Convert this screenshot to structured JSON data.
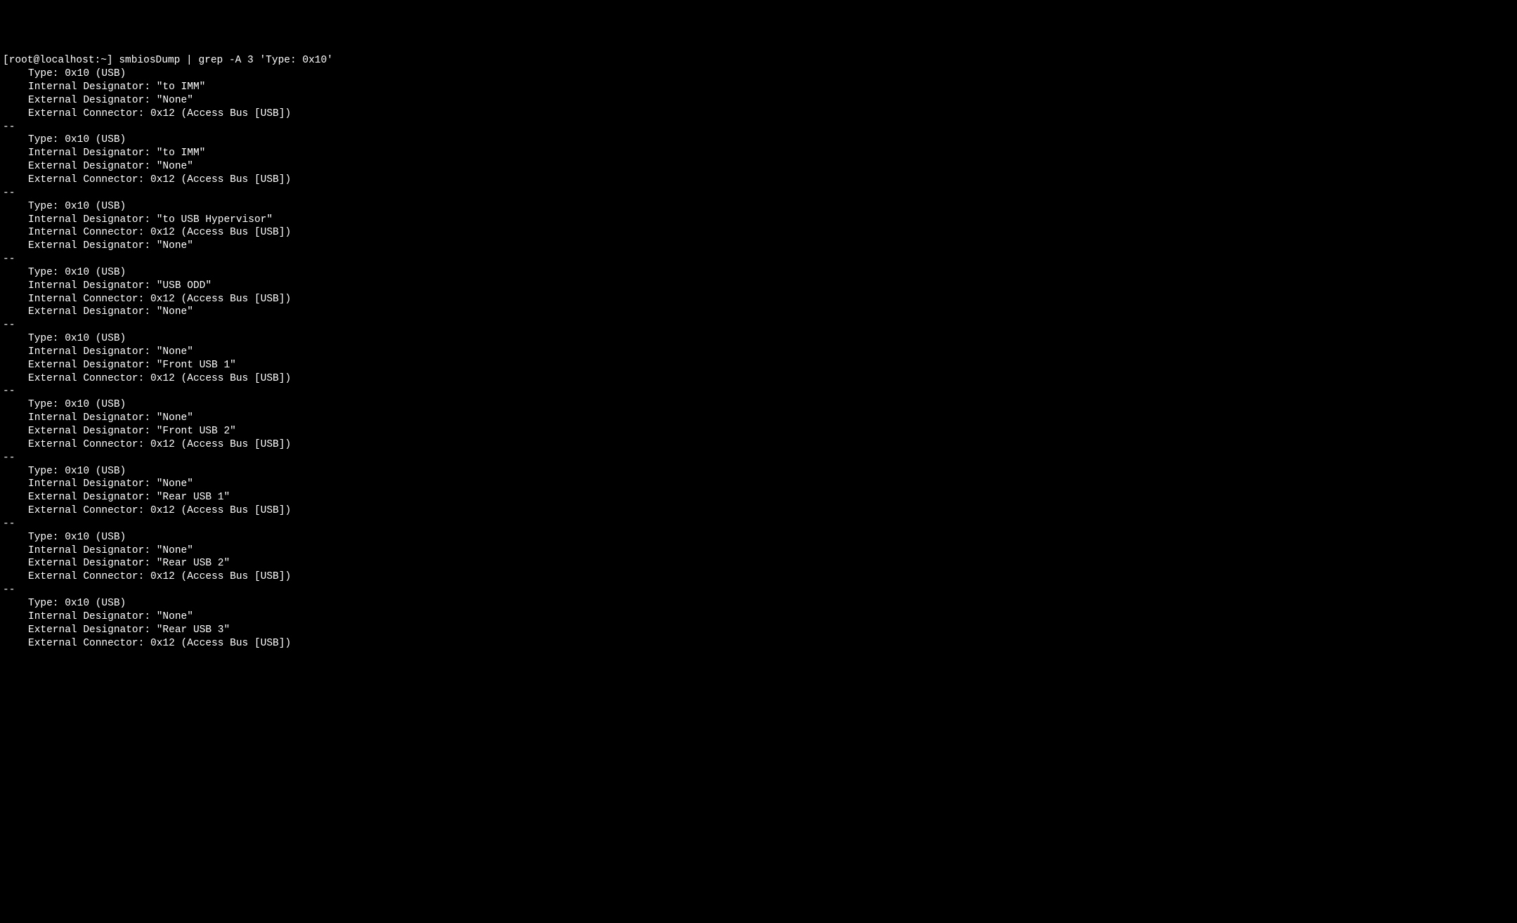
{
  "prompt": "[root@localhost:~] smbiosDump | grep -A 3 'Type: 0x10'",
  "separator": "--",
  "blocks": [
    {
      "lines": [
        "Type: 0x10 (USB)",
        "Internal Designator: \"to IMM\"",
        "External Designator: \"None\"",
        "External Connector: 0x12 (Access Bus [USB])"
      ]
    },
    {
      "lines": [
        "Type: 0x10 (USB)",
        "Internal Designator: \"to IMM\"",
        "External Designator: \"None\"",
        "External Connector: 0x12 (Access Bus [USB])"
      ]
    },
    {
      "lines": [
        "Type: 0x10 (USB)",
        "Internal Designator: \"to USB Hypervisor\"",
        "Internal Connector: 0x12 (Access Bus [USB])",
        "External Designator: \"None\""
      ]
    },
    {
      "lines": [
        "Type: 0x10 (USB)",
        "Internal Designator: \"USB ODD\"",
        "Internal Connector: 0x12 (Access Bus [USB])",
        "External Designator: \"None\""
      ]
    },
    {
      "lines": [
        "Type: 0x10 (USB)",
        "Internal Designator: \"None\"",
        "External Designator: \"Front USB 1\"",
        "External Connector: 0x12 (Access Bus [USB])"
      ]
    },
    {
      "lines": [
        "Type: 0x10 (USB)",
        "Internal Designator: \"None\"",
        "External Designator: \"Front USB 2\"",
        "External Connector: 0x12 (Access Bus [USB])"
      ]
    },
    {
      "lines": [
        "Type: 0x10 (USB)",
        "Internal Designator: \"None\"",
        "External Designator: \"Rear USB 1\"",
        "External Connector: 0x12 (Access Bus [USB])"
      ]
    },
    {
      "lines": [
        "Type: 0x10 (USB)",
        "Internal Designator: \"None\"",
        "External Designator: \"Rear USB 2\"",
        "External Connector: 0x12 (Access Bus [USB])"
      ]
    },
    {
      "lines": [
        "Type: 0x10 (USB)",
        "Internal Designator: \"None\"",
        "External Designator: \"Rear USB 3\"",
        "External Connector: 0x12 (Access Bus [USB])"
      ]
    }
  ]
}
